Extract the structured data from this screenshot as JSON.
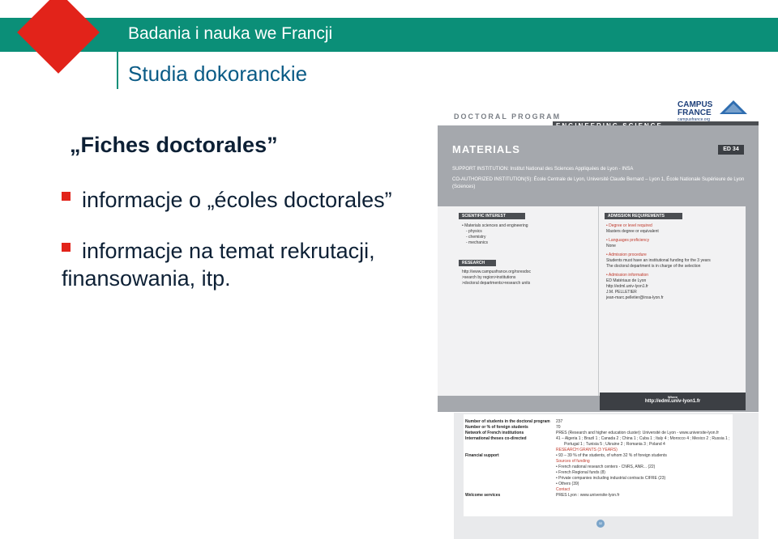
{
  "header": {
    "title": "Badania i nauka we Francji",
    "subtitle": "Studia dokoranckie"
  },
  "content": {
    "fiches": "„Fiches doctorales”",
    "bullets": [
      "informacje o „écoles doctorales”",
      "informacje na temat rekrutacji, finansowania, itp."
    ]
  },
  "document": {
    "program_label": "DOCTORAL PROGRAM",
    "engineering_label": "ENGINEERING SCIENCE",
    "logo_line1": "CAMPUS",
    "logo_line2": "FRANCE",
    "logo_line3": "campusfrance.org",
    "materials": "MATERIALS",
    "ed": "ED 34",
    "support": "SUPPORT INSTITUTION: Institut National des Sciences Appliquées de Lyon - INSA",
    "co_auth": "CO-AUTHORIZED INSTITUTION(S): École Centrale de Lyon, Université Claude Bernard – Lyon 1, École Nationale Supérieure de Lyon (Sciences)",
    "scientific_interest": "SCIENTIFIC INTEREST",
    "interest_lines": [
      "• Materials sciences and engineering",
      "- physics",
      "- chemistry",
      "- mechanics"
    ],
    "research_units": "RESEARCH UNITS",
    "unit_lines": [
      "http://www.campusfrance.org/rsresdoc",
      ">search by region>institutions",
      ">doctoral departments>research units"
    ],
    "admission": "ADMISSION REQUIREMENTS",
    "admission_lines": [
      "• Degree or level required",
      "Masters degree or equivalent",
      "",
      "• Languages proficiency",
      "None",
      "",
      "• Admission procedure",
      "Students must have an institutional funding for the 3 years",
      "The doctoral department is in charge of the selection",
      "",
      "• Admission information",
      "ED Matériaux de Lyon",
      "http://edml.univ-lyon1.fr",
      "J.M. PELLETIER",
      "jean-marc.pelletier@insa-lyon.fr"
    ],
    "where": "Where",
    "url": "http://edml.univ-lyon1.fr",
    "stats_labels": [
      "Number of students in the doctoral program",
      "Number or % of foreign students",
      "Network of French institutions",
      "International theses co-directed",
      "",
      "",
      "Financial support",
      "",
      "",
      "",
      "",
      "",
      "",
      "Welcome services"
    ],
    "stats_values": [
      "237",
      "70",
      "PRES (Research and higher education cluster): Université de Lyon - www.universite-lyon.fr",
      "41 – Algeria 1 ; Brazil 1 ; Canada 2 ; China 1 ; Cuba 1 ; Italy 4 ; Morocco 4 ; Mexico 2 ; Russia 1 ;",
      "Portugal 1 ; Tunisia 5 ; Ukraine 2 ; Romania 3 ; Poland 4",
      "RESEARCH GRANTS (3 YEARS)",
      "• 93 – 39 % of the students, of whom 32 % of foreign students",
      "Sources of funding",
      "• French national research centers - CNRS, ANR... (22)",
      "• French Regional funds (8)",
      "• Private companies including industrial contracts CIFRE (23)",
      "• Others (39)",
      "Contact",
      "PRES Lyon : www.universite-lyon.fr"
    ],
    "page_number": "32"
  }
}
